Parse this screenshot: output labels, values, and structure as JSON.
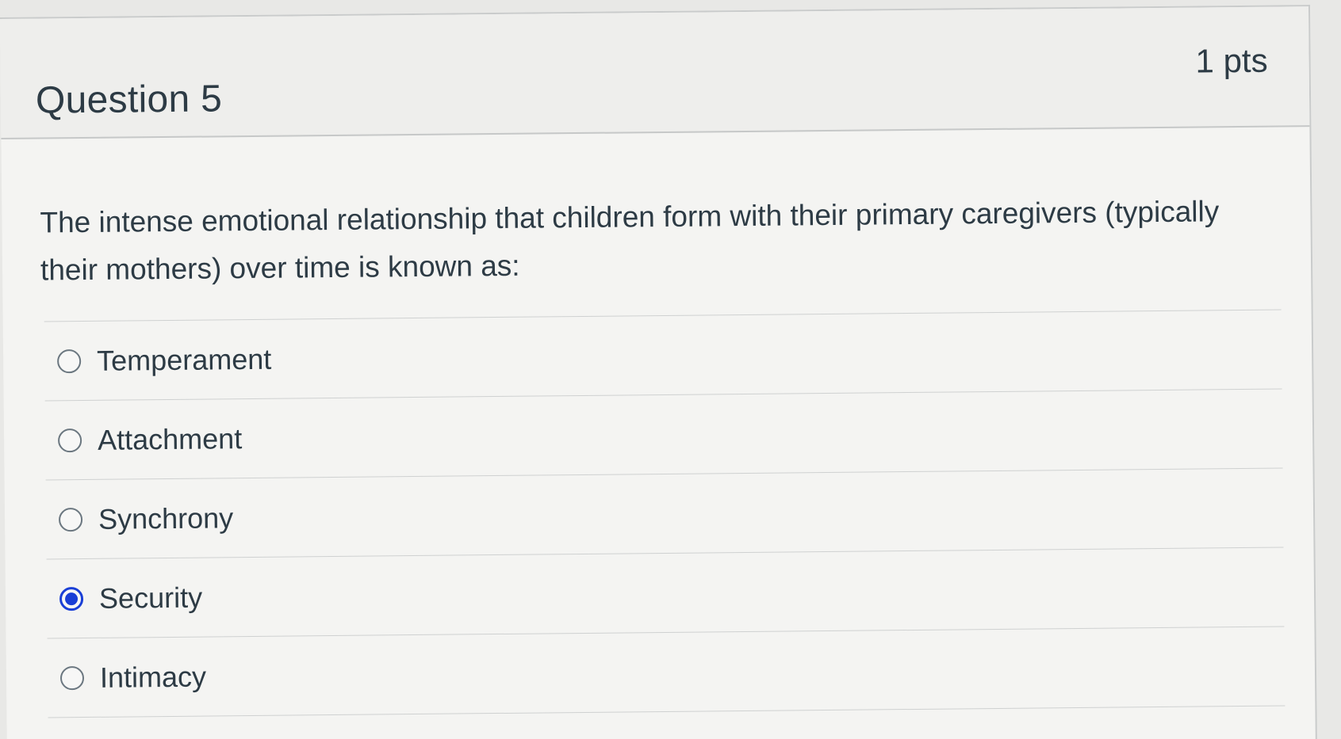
{
  "question": {
    "title": "Question 5",
    "points": "1 pts",
    "text": "The intense emotional relationship that children form with their primary caregivers (typically their mothers) over time is known as:"
  },
  "answers": [
    {
      "label": "Temperament",
      "selected": false
    },
    {
      "label": "Attachment",
      "selected": false
    },
    {
      "label": "Synchrony",
      "selected": false
    },
    {
      "label": "Security",
      "selected": true
    },
    {
      "label": "Intimacy",
      "selected": false
    }
  ],
  "colors": {
    "text": "#2d3b45",
    "selected_radio": "#1a3fd6",
    "header_bg": "#eeeeec",
    "card_bg": "#f4f4f2"
  }
}
